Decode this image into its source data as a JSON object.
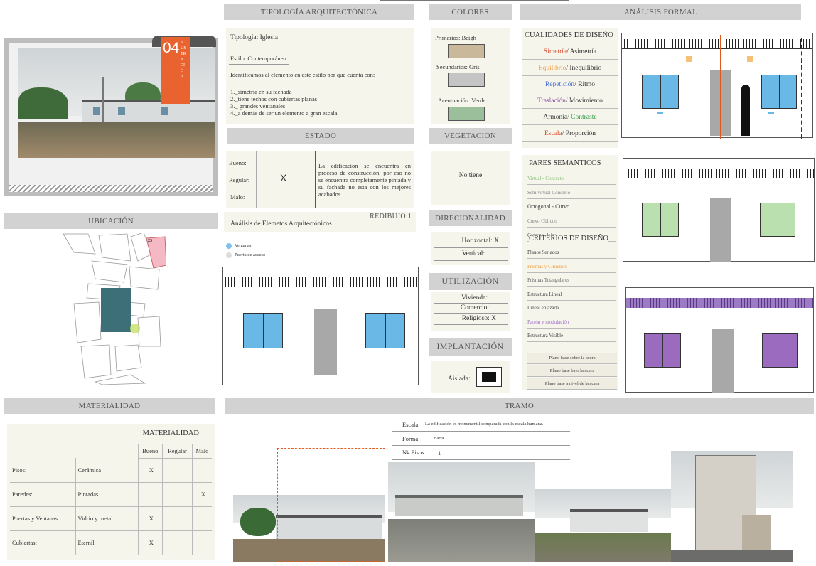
{
  "headers": {
    "tipologia": "TIPOLOGÍA ARQUITECTÓNICA",
    "colores": "COLORES",
    "analisis": "ANÁLISIS FORMAL",
    "estado": "ESTADO",
    "vegetacion": "VEGETACIÓN",
    "ubicacion": "UBICACIÓN",
    "direccionalidad": "DIRECIONALIDAD",
    "utilizacion": "UTILIZACIÓN",
    "implantacion": "IMPLANTACIÓN",
    "materialidad": "MATERIALIDAD",
    "tramo": "TRAMO"
  },
  "badge": {
    "number": "04",
    "text": "ILUSTRACIÓN"
  },
  "tipologia": {
    "line1": "Tipología: Iglesia",
    "line2": "Estilo: Contemporáneo",
    "line3": "Identificamos al elemento en este estilo por que cuenta con:",
    "items": [
      "1._simetría en su fachada",
      "2._tiene techos con cubiertas planas",
      "3._ grandes ventanales",
      "4._a demás de ser un elemento a gran escala."
    ]
  },
  "colores": {
    "primarios": "Primarios: Beigh",
    "secundarios": "Secundarios: Gris",
    "acentuacion": "Acentuación: Verde",
    "c1": "#c9b89a",
    "c2": "#c4c4c4",
    "c3": "#9bbf9b"
  },
  "estado": {
    "bueno": "Bueno:",
    "regular": "Regular:",
    "malo": "Malo:",
    "mark": "X",
    "text": "La edificación se encuentra en proceso de construcción, por eso no se encuentra completamente pintada y su fachada no esta con los mejores acabados."
  },
  "vegetacion": {
    "text": "No tiene"
  },
  "redibujo": {
    "title": "REDIBUJO 1",
    "subtitle": "Análisis de Elemetos Arquitectónicos",
    "legend1": "Ventanas",
    "legend2": "Puerta de acceso"
  },
  "direccionalidad": {
    "h": "Horizontal: X",
    "v": "Vertical:"
  },
  "utilizacion": {
    "a": "Vivienda:",
    "b": "Comercio:",
    "c": "Religioso: X"
  },
  "implantacion": {
    "label": "Aislada:"
  },
  "cualidades": {
    "title": "CUALIDADES DE DISEÑO",
    "items": [
      {
        "a": "Simetría",
        "b": "/ Asimetría",
        "ca": "#d94a2a",
        "cb": "#333"
      },
      {
        "a": "Equilibrio",
        "b": "/ Inequilibrio",
        "ca": "#f0a040",
        "cb": "#333"
      },
      {
        "a": "Repetición",
        "b": "/ Ritmo",
        "ca": "#4a6fd0",
        "cb": "#333"
      },
      {
        "a": "Traslación",
        "b": "/ Movimiento",
        "ca": "#8a4aa0",
        "cb": "#333"
      },
      {
        "a": "Armonía",
        "b": "/ Contraste",
        "ca": "#444",
        "cb": "#2f9a48"
      },
      {
        "a": "Escala",
        "b": "/ Proporción",
        "ca": "#d94a2a",
        "cb": "#333"
      }
    ]
  },
  "pares": {
    "title": "PARES SEMÁNTICOS",
    "items": [
      "Virtual - Concreto",
      "Semivirtual  Concreto",
      "Ortogonal - Curvo",
      "Curvo   Oblicuo",
      "Cercano- lejos"
    ]
  },
  "criterios": {
    "title": "CRITERIOS DE DISEÑO",
    "items": [
      "Planos Seriados",
      "Prismas y Cilindros",
      "Prismas Triangulares",
      "Estructura Lineal",
      "Lineal enlazada",
      "Patrón y modulación",
      "Estructura Visible"
    ],
    "planos": [
      "Plano base sobre la acera",
      "Plano base bajo la acera",
      "Plano base a nivel de la acera"
    ]
  },
  "materialidad": {
    "title": "MATERIALIDAD",
    "cols": [
      "Bueno",
      "Regular",
      "Malo"
    ],
    "rows": [
      {
        "name": "Pisos:",
        "mat": "Cerámica",
        "bueno": "X",
        "regular": "",
        "malo": ""
      },
      {
        "name": "Paredes:",
        "mat": "Pintadas",
        "bueno": "",
        "regular": "",
        "malo": "X"
      },
      {
        "name": "Puertas y Ventanas:",
        "mat": "Vidrio y metal",
        "bueno": "X",
        "regular": "",
        "malo": ""
      },
      {
        "name": "Cubiertas:",
        "mat": "Eternil",
        "bueno": "X",
        "regular": "",
        "malo": ""
      }
    ]
  },
  "tramo": {
    "escala_l": "Escala:",
    "escala_v": "La edificación es monumentil comparada con la escala humana.",
    "forma_l": "Forma:",
    "forma_v": "Barra",
    "pisos_l": "N# Pisos:",
    "pisos_v": "1"
  },
  "map": {
    "lot": "23"
  }
}
